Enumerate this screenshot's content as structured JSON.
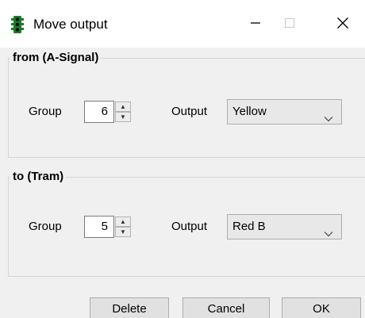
{
  "window": {
    "title": "Move output",
    "app_icon": "traffic-light-icon",
    "controls": [
      "minimize-icon",
      "maximize-icon",
      "close-icon"
    ]
  },
  "from_section": {
    "title": "from (A-Signal)",
    "group_label": "Group",
    "group_value": "6",
    "output_label": "Output",
    "output_value": "Yellow"
  },
  "to_section": {
    "title": "to (Tram)",
    "group_label": "Group",
    "group_value": "5",
    "output_label": "Output",
    "output_value": "Red B"
  },
  "buttons": {
    "delete": "Delete",
    "cancel": "Cancel",
    "ok": "OK"
  },
  "colors": {
    "dialog_background": "#f0f0f0",
    "titlebar": "#ffffff",
    "traffic_light_body": "#1a7a2a"
  }
}
